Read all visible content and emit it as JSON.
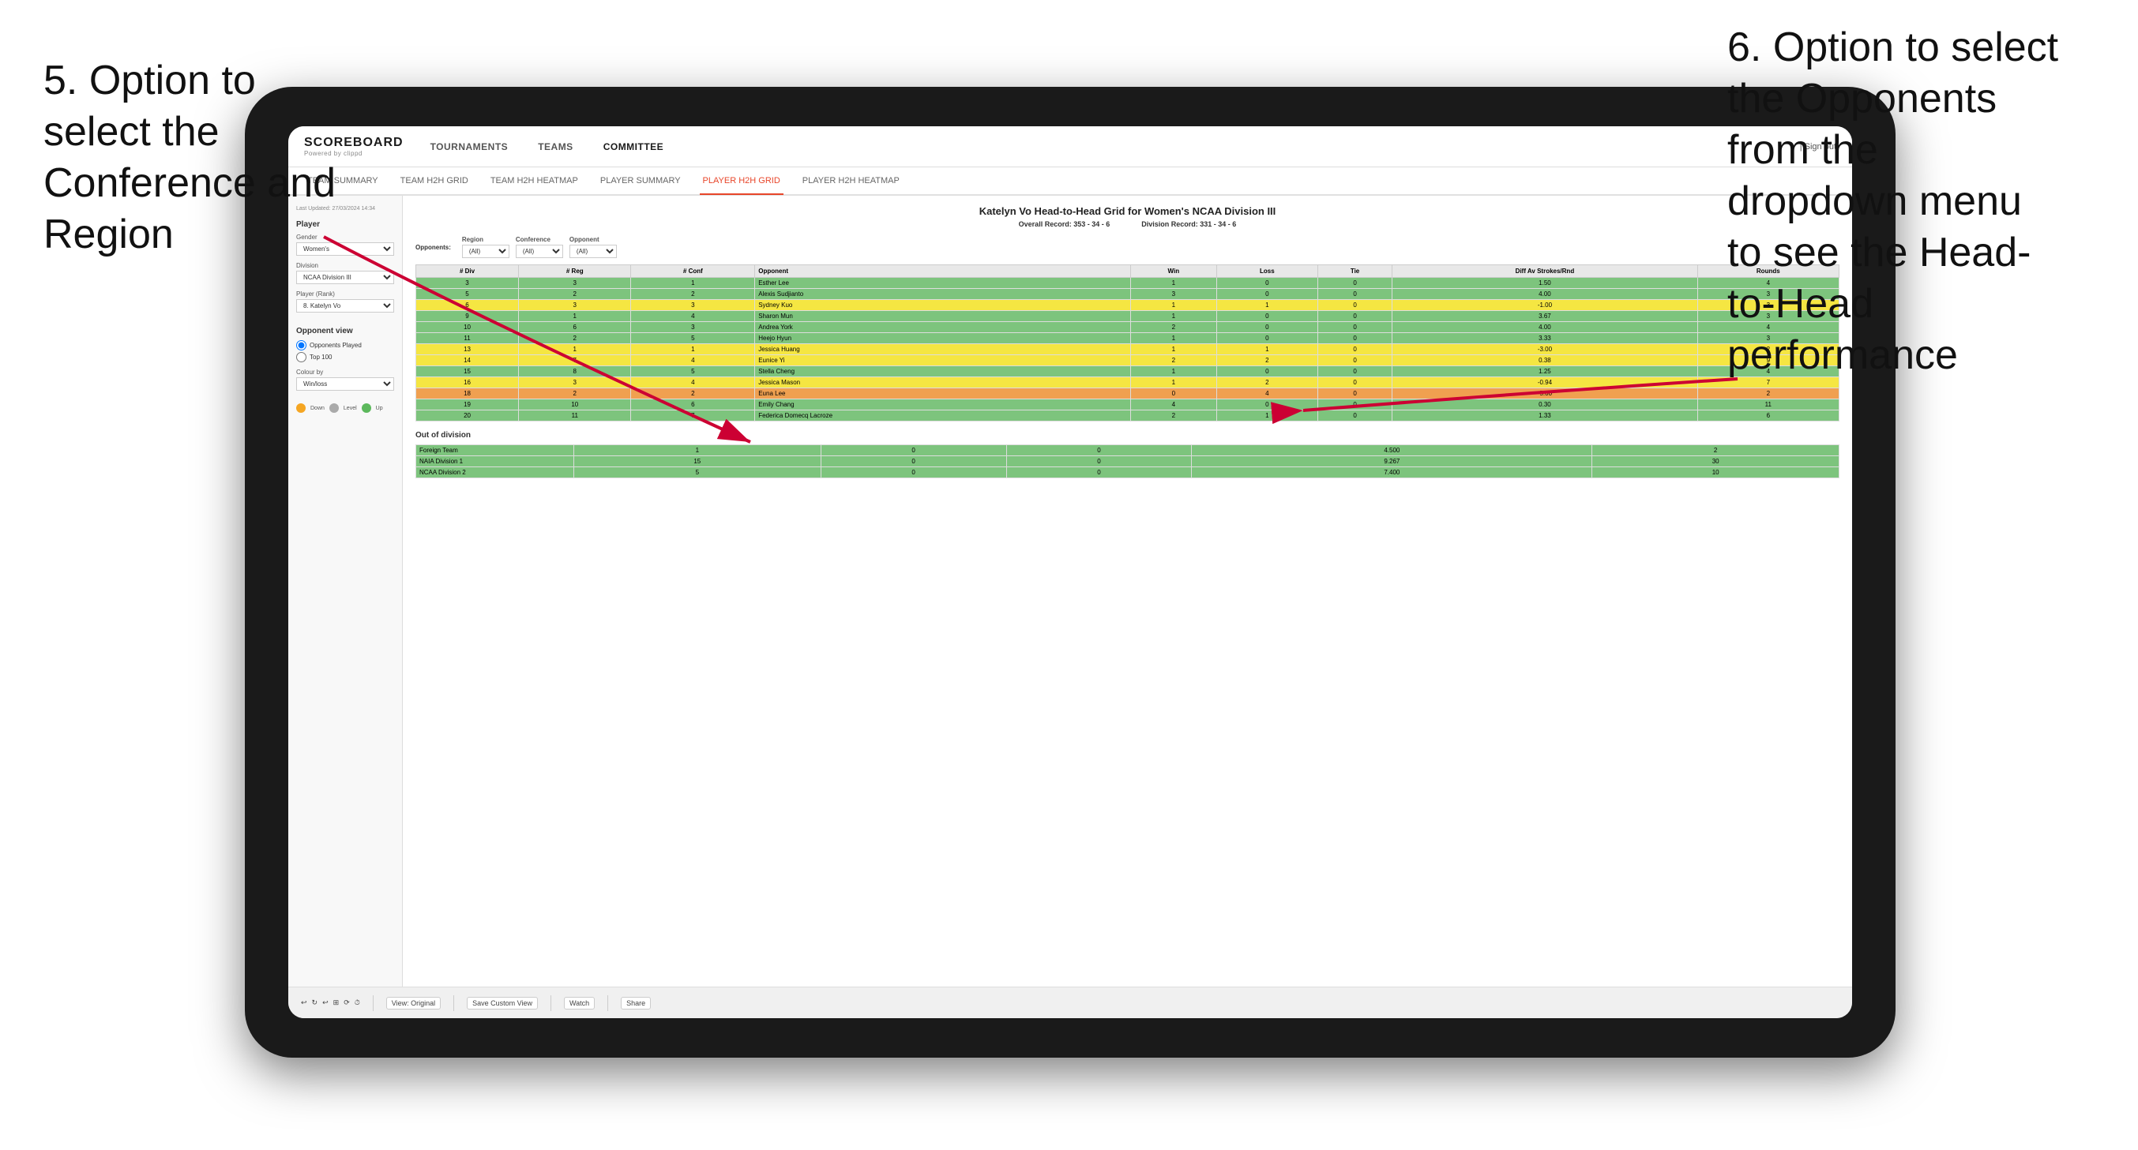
{
  "annotations": {
    "left": {
      "line1": "5. Option to",
      "line2": "select the",
      "line3": "Conference and",
      "line4": "Region"
    },
    "right": {
      "line1": "6. Option to select",
      "line2": "the Opponents",
      "line3": "from the",
      "line4": "dropdown menu",
      "line5": "to see the Head-",
      "line6": "to-Head",
      "line7": "performance"
    }
  },
  "nav": {
    "logo": "SCOREBOARD",
    "logo_sub": "Powered by clippd",
    "items": [
      "TOURNAMENTS",
      "TEAMS",
      "COMMITTEE"
    ],
    "sign_out": "| Sign out"
  },
  "sub_nav": {
    "items": [
      "TEAM SUMMARY",
      "TEAM H2H GRID",
      "TEAM H2H HEATMAP",
      "PLAYER SUMMARY",
      "PLAYER H2H GRID",
      "PLAYER H2H HEATMAP"
    ]
  },
  "sidebar": {
    "last_updated": "Last Updated: 27/03/2024 14:34",
    "player_label": "Player",
    "gender_label": "Gender",
    "gender_value": "Women's",
    "division_label": "Division",
    "division_value": "NCAA Division III",
    "player_rank_label": "Player (Rank)",
    "player_rank_value": "8. Katelyn Vo",
    "opponent_view_label": "Opponent view",
    "radio1": "Opponents Played",
    "radio2": "Top 100",
    "colour_by_label": "Colour by",
    "colour_by_value": "Win/loss",
    "color_labels": [
      "Down",
      "Level",
      "Up"
    ]
  },
  "content": {
    "title": "Katelyn Vo Head-to-Head Grid for Women's NCAA Division III",
    "overall_record_label": "Overall Record:",
    "overall_record": "353 - 34 - 6",
    "division_record_label": "Division Record:",
    "division_record": "331 - 34 - 6",
    "region_label": "Region",
    "conference_label": "Conference",
    "opponent_label": "Opponent",
    "opponents_label": "Opponents:",
    "region_value": "(All)",
    "conference_value": "(All)",
    "opponent_value": "(All)",
    "table_headers": [
      "# Div",
      "# Reg",
      "# Conf",
      "Opponent",
      "Win",
      "Loss",
      "Tie",
      "Diff Av Strokes/Rnd",
      "Rounds"
    ],
    "rows": [
      {
        "div": "3",
        "reg": "3",
        "conf": "1",
        "opponent": "Esther Lee",
        "win": "1",
        "loss": "0",
        "tie": "0",
        "diff": "1.50",
        "rounds": "4",
        "color": "green"
      },
      {
        "div": "5",
        "reg": "2",
        "conf": "2",
        "opponent": "Alexis Sudjianto",
        "win": "3",
        "loss": "0",
        "tie": "0",
        "diff": "4.00",
        "rounds": "3",
        "color": "green"
      },
      {
        "div": "6",
        "reg": "3",
        "conf": "3",
        "opponent": "Sydney Kuo",
        "win": "1",
        "loss": "1",
        "tie": "0",
        "diff": "-1.00",
        "rounds": "3",
        "color": "yellow"
      },
      {
        "div": "9",
        "reg": "1",
        "conf": "4",
        "opponent": "Sharon Mun",
        "win": "1",
        "loss": "0",
        "tie": "0",
        "diff": "3.67",
        "rounds": "3",
        "color": "green"
      },
      {
        "div": "10",
        "reg": "6",
        "conf": "3",
        "opponent": "Andrea York",
        "win": "2",
        "loss": "0",
        "tie": "0",
        "diff": "4.00",
        "rounds": "4",
        "color": "green"
      },
      {
        "div": "11",
        "reg": "2",
        "conf": "5",
        "opponent": "Heejo Hyun",
        "win": "1",
        "loss": "0",
        "tie": "0",
        "diff": "3.33",
        "rounds": "3",
        "color": "green"
      },
      {
        "div": "13",
        "reg": "1",
        "conf": "1",
        "opponent": "Jessica Huang",
        "win": "1",
        "loss": "1",
        "tie": "0",
        "diff": "-3.00",
        "rounds": "2",
        "color": "yellow"
      },
      {
        "div": "14",
        "reg": "7",
        "conf": "4",
        "opponent": "Eunice Yi",
        "win": "2",
        "loss": "2",
        "tie": "0",
        "diff": "0.38",
        "rounds": "9",
        "color": "yellow"
      },
      {
        "div": "15",
        "reg": "8",
        "conf": "5",
        "opponent": "Stella Cheng",
        "win": "1",
        "loss": "0",
        "tie": "0",
        "diff": "1.25",
        "rounds": "4",
        "color": "green"
      },
      {
        "div": "16",
        "reg": "3",
        "conf": "4",
        "opponent": "Jessica Mason",
        "win": "1",
        "loss": "2",
        "tie": "0",
        "diff": "-0.94",
        "rounds": "7",
        "color": "yellow"
      },
      {
        "div": "18",
        "reg": "2",
        "conf": "2",
        "opponent": "Euna Lee",
        "win": "0",
        "loss": "4",
        "tie": "0",
        "diff": "-5.00",
        "rounds": "2",
        "color": "orange"
      },
      {
        "div": "19",
        "reg": "10",
        "conf": "6",
        "opponent": "Emily Chang",
        "win": "4",
        "loss": "0",
        "tie": "0",
        "diff": "0.30",
        "rounds": "11",
        "color": "green"
      },
      {
        "div": "20",
        "reg": "11",
        "conf": "7",
        "opponent": "Federica Domecq Lacroze",
        "win": "2",
        "loss": "1",
        "tie": "0",
        "diff": "1.33",
        "rounds": "6",
        "color": "green"
      }
    ],
    "out_of_division_label": "Out of division",
    "out_of_division_rows": [
      {
        "opponent": "Foreign Team",
        "win": "1",
        "loss": "0",
        "tie": "0",
        "diff": "4.500",
        "rounds": "2",
        "color": "green"
      },
      {
        "opponent": "NAIA Division 1",
        "win": "15",
        "loss": "0",
        "tie": "0",
        "diff": "9.267",
        "rounds": "30",
        "color": "green"
      },
      {
        "opponent": "NCAA Division 2",
        "win": "5",
        "loss": "0",
        "tie": "0",
        "diff": "7.400",
        "rounds": "10",
        "color": "green"
      }
    ]
  },
  "toolbar": {
    "view_original": "View: Original",
    "save_custom": "Save Custom View",
    "watch": "Watch",
    "share": "Share"
  }
}
